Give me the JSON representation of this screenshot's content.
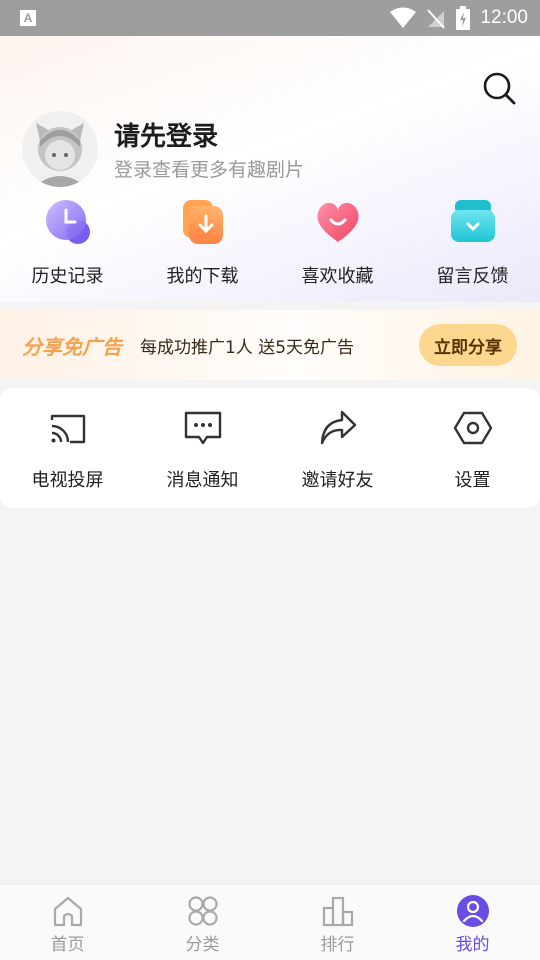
{
  "status_bar": {
    "time": "12:00",
    "app_indicator": "A"
  },
  "profile": {
    "title": "请先登录",
    "subtitle": "登录查看更多有趣剧片"
  },
  "quick_actions": [
    {
      "label": "历史记录",
      "icon": "history-icon"
    },
    {
      "label": "我的下载",
      "icon": "download-icon"
    },
    {
      "label": "喜欢收藏",
      "icon": "favorite-heart-icon"
    },
    {
      "label": "留言反馈",
      "icon": "feedback-icon"
    }
  ],
  "banner": {
    "title": "分享免广告",
    "text": "每成功推广1人 送5天免广告",
    "button": "立即分享"
  },
  "tools": [
    {
      "label": "电视投屏",
      "icon": "cast-icon"
    },
    {
      "label": "消息通知",
      "icon": "message-icon"
    },
    {
      "label": "邀请好友",
      "icon": "share-arrow-icon"
    },
    {
      "label": "设置",
      "icon": "settings-hexagon-icon"
    }
  ],
  "bottom_nav": [
    {
      "label": "首页",
      "icon": "home-icon"
    },
    {
      "label": "分类",
      "icon": "category-icon"
    },
    {
      "label": "排行",
      "icon": "ranking-icon"
    },
    {
      "label": "我的",
      "icon": "profile-icon",
      "active": true
    }
  ],
  "colors": {
    "accent": "#6b4de6",
    "banner_title": "#f3a24d",
    "banner_button": "#fcd790",
    "status_bar": "#9e9e9e"
  }
}
